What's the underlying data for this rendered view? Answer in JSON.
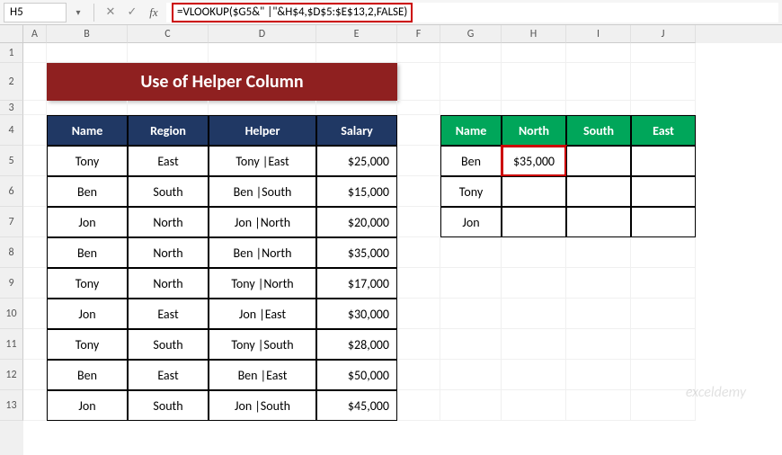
{
  "name_box": "H5",
  "formula": "=VLOOKUP($G5&\" |\"&H$4,$D$5:$E$13,2,FALSE)",
  "columns": [
    "A",
    "B",
    "C",
    "D",
    "E",
    "F",
    "G",
    "H",
    "I",
    "J"
  ],
  "rows": [
    "1",
    "2",
    "3",
    "4",
    "5",
    "6",
    "7",
    "8",
    "9",
    "10",
    "11",
    "12",
    "13"
  ],
  "title": "Use of Helper Column",
  "table1": {
    "headers": [
      "Name",
      "Region",
      "Helper",
      "Salary"
    ],
    "rows": [
      [
        "Tony",
        "East",
        "Tony |East",
        "$25,000"
      ],
      [
        "Ben",
        "South",
        "Ben |South",
        "$15,000"
      ],
      [
        "Jon",
        "North",
        "Jon |North",
        "$20,000"
      ],
      [
        "Ben",
        "North",
        "Ben |North",
        "$35,000"
      ],
      [
        "Tony",
        "North",
        "Tony |North",
        "$17,000"
      ],
      [
        "Jon",
        "East",
        "Jon |East",
        "$30,000"
      ],
      [
        "Tony",
        "South",
        "Tony |South",
        "$28,000"
      ],
      [
        "Ben",
        "East",
        "Ben |East",
        "$50,000"
      ],
      [
        "Jon",
        "South",
        "Jon |South",
        "$45,000"
      ]
    ]
  },
  "table2": {
    "headers": [
      "Name",
      "North",
      "South",
      "East"
    ],
    "rows": [
      [
        "Ben",
        "$35,000",
        "",
        ""
      ],
      [
        "Tony",
        "",
        "",
        ""
      ],
      [
        "Jon",
        "",
        "",
        ""
      ]
    ]
  },
  "watermark": "exceldemy"
}
